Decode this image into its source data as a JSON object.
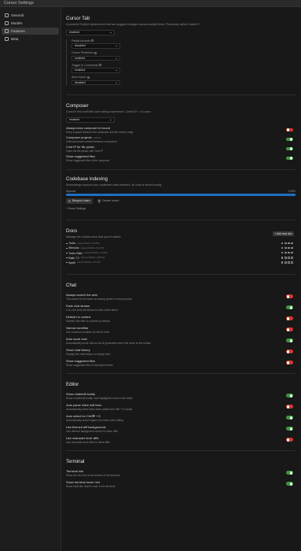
{
  "window": {
    "title": "Cursor Settings"
  },
  "sidebar": {
    "items": [
      {
        "label": "General",
        "icon": "gear-icon"
      },
      {
        "label": "Models",
        "icon": "cube-icon"
      },
      {
        "label": "Features",
        "icon": "features-icon",
        "active": true
      },
      {
        "label": "Beta",
        "icon": "beta-icon"
      }
    ]
  },
  "cursor_tab": {
    "title": "Cursor Tab",
    "desc": "A powerful Copilot replacement that can suggest changes across multiple lines. Previously called Copilot++.",
    "select_value": "enabled",
    "fields": [
      {
        "label": "Partial Accepts",
        "value": "disabled"
      },
      {
        "label": "Cursor Prediction",
        "value": "enabled"
      },
      {
        "label": "Trigger In Comments",
        "value": "enabled"
      },
      {
        "label": "Auto Import",
        "value": "disabled"
      }
    ]
  },
  "composer": {
    "title": "Composer",
    "desc": "Cursor's first multi-file code editing experience. Cmd/Ctrl + I to open.",
    "select_value": "enabled",
    "settings": [
      {
        "title": "Always keep composer in bound",
        "desc": "Keep a space between the composer and the screen edge",
        "on": false,
        "badge": ""
      },
      {
        "title": "Composer projects",
        "desc": "Craft and share context between composers",
        "on": true,
        "badge": "ALPHA"
      },
      {
        "title": "Cmd+P for file picker",
        "desc": "Open the file picker with Cmd+P",
        "on": true,
        "badge": ""
      },
      {
        "title": "Show suggested files",
        "desc": "Show suggested files in the composer",
        "on": true,
        "badge": ""
      }
    ]
  },
  "indexing": {
    "title": "Codebase indexing",
    "desc": "Embeddings improve your codebase-wide answers. All code is stored locally.",
    "status": "Synced",
    "percent_label": "100%",
    "progress": 1.0,
    "resync_label": "Resync Index",
    "delete_label": "Delete Index",
    "show_settings": "Show Settings"
  },
  "docs": {
    "title": "Docs",
    "desc": "Manage the custom docs that you've added.",
    "add_label": "+ Add new doc",
    "items": [
      {
        "name": "Turbo",
        "sub": "indexed 8/5/24, 2:44 PM"
      },
      {
        "name": "Stimulus",
        "sub": "indexed 8/30/24, 8:13 PM"
      },
      {
        "name": "Turbo Rails",
        "sub": "indexed 8/30/24, 1:12 PM"
      },
      {
        "name": "Rails 7.2",
        "sub": "indexed 8/30/24, 10:58 AM"
      },
      {
        "name": "Synth",
        "sub": "indexed 8/30/24, 4:37 PM"
      }
    ]
  },
  "chat": {
    "title": "Chat",
    "settings": [
      {
        "title": "Always search the web",
        "desc": "This would be the same as having @web in every prompt",
        "on": false
      },
      {
        "title": "Fade chat stream",
        "desc": "If on, the chat will stream in with a fade effect",
        "on": true
      },
      {
        "title": "Default no context",
        "desc": "Submit chat with no context by default",
        "on": false
      },
      {
        "title": "Narrow scrollbar",
        "desc": "Use a narrow scrollbar for the AI Chat",
        "on": false
      },
      {
        "title": "Auto scroll chat",
        "desc": "Automatically scroll chat as the AI generates more text when at the bottom",
        "on": true
      },
      {
        "title": "Show chat history",
        "desc": "Display the chat history on empty chat",
        "on": false
      },
      {
        "title": "Show suggested files",
        "desc": "Show suggested files in chat input boxes",
        "on": false
      }
    ]
  },
  "editor": {
    "title": "Editor",
    "settings": [
      {
        "title": "Show chat/edit tooltip",
        "desc": "Show a chat/edit tooltip near highlighted code in the editor",
        "on": true
      },
      {
        "title": "Auto parse inline edit links",
        "desc": "Automatically parse links when pasted into ⌘K + K inputs",
        "on": false
      },
      {
        "title": "Auto select for Ctrl/⌘ + K",
        "desc": "Automatically select regions for inline code editing",
        "on": true
      },
      {
        "title": "Use themed diff backgrounds",
        "desc": "Use themed background colors for inline diffs",
        "on": true
      },
      {
        "title": "Use character level diffs",
        "desc": "Use character-level diffs for inline diffs",
        "on": false
      }
    ]
  },
  "terminal": {
    "title": "Terminal",
    "settings": [
      {
        "title": "Terminal hint",
        "desc": "Show the hint text at the bottom of the terminal",
        "on": true
      },
      {
        "title": "Show terminal hover hint",
        "desc": "Show hints like 'Add to chat' in the terminal",
        "on": true
      }
    ]
  },
  "colors": {
    "toggle_on": "#3a9a40",
    "toggle_off": "#d03a2e",
    "progress": "#1f6fc2"
  }
}
